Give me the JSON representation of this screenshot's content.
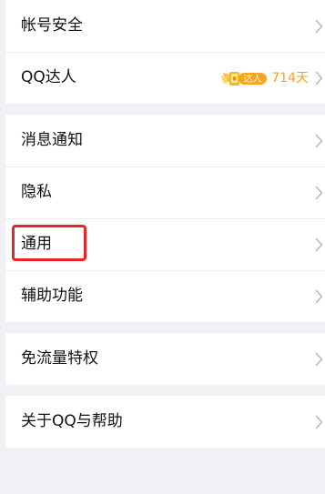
{
  "settings": {
    "groups": [
      {
        "items": [
          {
            "label": "帐号安全"
          },
          {
            "label": "QQ达人",
            "badge_text": "达人",
            "days": "714天"
          }
        ]
      },
      {
        "items": [
          {
            "label": "消息通知"
          },
          {
            "label": "隐私"
          },
          {
            "label": "通用"
          },
          {
            "label": "辅助功能"
          }
        ]
      },
      {
        "items": [
          {
            "label": "免流量特权"
          }
        ]
      },
      {
        "items": [
          {
            "label": "关于QQ与帮助"
          }
        ]
      }
    ]
  },
  "annotation": {
    "highlighted_item": "通用",
    "color": "#e8242b"
  },
  "colors": {
    "background": "#f0f0f5",
    "card": "#ffffff",
    "text": "#111111",
    "chevron": "#b8b8bd",
    "badge_accent": "#f2a41f"
  },
  "icons": {
    "chevron": "chevron-right-icon",
    "master_badge": "qq-master-badge-icon"
  }
}
